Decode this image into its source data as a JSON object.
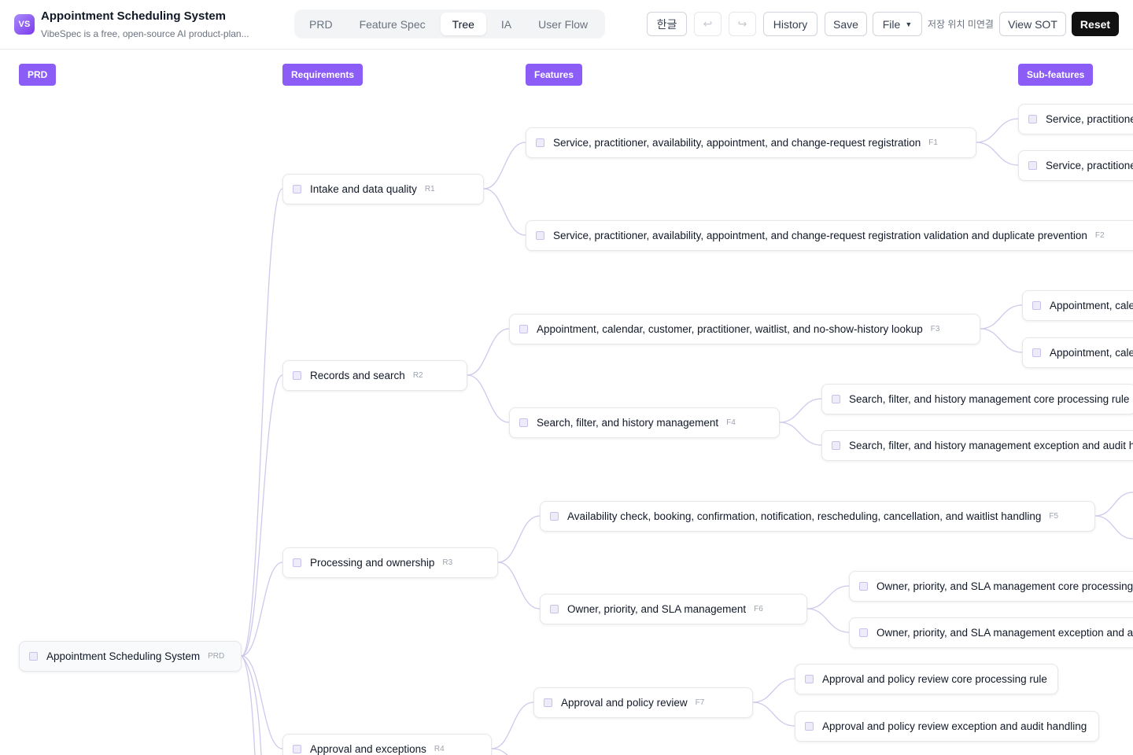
{
  "app": {
    "logo": "VS",
    "title": "Appointment Scheduling System",
    "subtitle": "VibeSpec is a free, open-source AI product-plan..."
  },
  "tabs": [
    {
      "label": "PRD",
      "active": false
    },
    {
      "label": "Feature Spec",
      "active": false
    },
    {
      "label": "Tree",
      "active": true
    },
    {
      "label": "IA",
      "active": false
    },
    {
      "label": "User Flow",
      "active": false
    }
  ],
  "toolbar": {
    "language": "한글",
    "undo_icon": "undo-icon",
    "redo_icon": "redo-icon",
    "history": "History",
    "save": "Save",
    "file": "File",
    "save_status": "저장 위치 미연결",
    "view_sot": "View SOT",
    "reset": "Reset"
  },
  "columns": [
    "PRD",
    "Requirements",
    "Features",
    "Sub-features"
  ],
  "tree": {
    "root": {
      "label": "Appointment Scheduling System",
      "code": "PRD"
    },
    "requirements": [
      {
        "label": "Intake and data quality",
        "code": "R1"
      },
      {
        "label": "Records and search",
        "code": "R2"
      },
      {
        "label": "Processing and ownership",
        "code": "R3"
      },
      {
        "label": "Approval and exceptions",
        "code": "R4"
      }
    ],
    "features": [
      {
        "label": "Service, practitioner, availability, appointment, and change-request registration",
        "code": "F1"
      },
      {
        "label": "Service, practitioner, availability, appointment, and change-request registration validation and duplicate prevention",
        "code": "F2"
      },
      {
        "label": "Appointment, calendar, customer, practitioner, waitlist, and no-show-history lookup",
        "code": "F3"
      },
      {
        "label": "Search, filter, and history management",
        "code": "F4"
      },
      {
        "label": "Availability check, booking, confirmation, notification, rescheduling, cancellation, and waitlist handling",
        "code": "F5"
      },
      {
        "label": "Owner, priority, and SLA management",
        "code": "F6"
      },
      {
        "label": "Approval and policy review",
        "code": "F7"
      }
    ],
    "subfeatures": [
      {
        "label": "Service, practitioner"
      },
      {
        "label": "Service, practitioner"
      },
      {
        "label": "Appointment, caler"
      },
      {
        "label": "Appointment, caler"
      },
      {
        "label": "Search, filter, and history management core processing rule"
      },
      {
        "label": "Search, filter, and history management exception and audit hanc"
      },
      {
        "label": "Owner, priority, and SLA management core processing rul"
      },
      {
        "label": "Owner, priority, and SLA management exception and audi"
      },
      {
        "label": "Approval and policy review core processing rule"
      },
      {
        "label": "Approval and policy review exception and audit handling"
      }
    ]
  }
}
